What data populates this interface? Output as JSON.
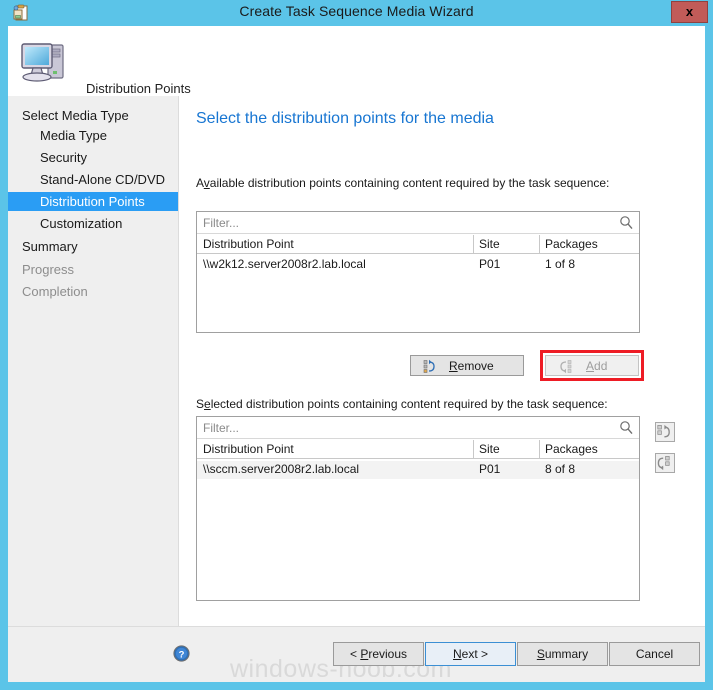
{
  "window": {
    "title": "Create Task Sequence Media Wizard",
    "title_icon": "task-sequence-clipboard-icon",
    "close_label": "x",
    "border_color": "#5bc4e8"
  },
  "header": {
    "icon": "computer-monitor-icon",
    "title": "Distribution Points"
  },
  "sidebar": {
    "items": [
      {
        "label": "Select Media Type",
        "level": 0,
        "state": "normal"
      },
      {
        "label": "Media Type",
        "level": 1,
        "state": "normal"
      },
      {
        "label": "Security",
        "level": 1,
        "state": "normal"
      },
      {
        "label": "Stand-Alone CD/DVD",
        "level": 1,
        "state": "normal"
      },
      {
        "label": "Distribution Points",
        "level": 1,
        "state": "selected"
      },
      {
        "label": "Customization",
        "level": 1,
        "state": "normal"
      },
      {
        "label": "Summary",
        "level": 0,
        "state": "normal"
      },
      {
        "label": "Progress",
        "level": 0,
        "state": "disabled"
      },
      {
        "label": "Completion",
        "level": 0,
        "state": "disabled"
      }
    ],
    "selected_color": "#2a9df4"
  },
  "main": {
    "heading": "Select the distribution points for the media",
    "heading_color": "#1876d2",
    "available": {
      "label_prefix": "A",
      "label_accel": "v",
      "label_suffix": "ailable distribution points containing content required by the task sequence:",
      "filter_placeholder": "Filter...",
      "search_icon": "search-icon",
      "columns": [
        "Distribution Point",
        "Site",
        "Packages"
      ],
      "rows": [
        {
          "dp": "\\\\w2k12.server2008r2.lab.local",
          "site": "P01",
          "packages": "1 of 8",
          "selected": false
        }
      ]
    },
    "selected_list": {
      "label_prefix": "S",
      "label_accel": "e",
      "label_suffix": "lected distribution points containing content required by the task sequence:",
      "filter_placeholder": "Filter...",
      "search_icon": "search-icon",
      "columns": [
        "Distribution Point",
        "Site",
        "Packages"
      ],
      "rows": [
        {
          "dp": "\\\\sccm.server2008r2.lab.local",
          "site": "P01",
          "packages": "8 of 8",
          "selected": true
        }
      ]
    },
    "transfer_buttons": {
      "remove": {
        "prefix": "",
        "accel": "R",
        "suffix": "emove",
        "icon": "remove-list-icon",
        "enabled": true
      },
      "add": {
        "prefix": "",
        "accel": "A",
        "suffix": "dd",
        "icon": "add-list-icon",
        "enabled": false,
        "highlight_color": "#ee1c25"
      }
    },
    "side_icon_buttons": [
      {
        "icon": "move-out-icon"
      },
      {
        "icon": "move-in-icon"
      }
    ]
  },
  "footer": {
    "help_icon": "help-question-icon",
    "watermark": "windows-noob.com",
    "buttons": [
      {
        "prefix": "< ",
        "accel": "P",
        "suffix": "revious",
        "focused": false
      },
      {
        "prefix": "",
        "accel": "N",
        "suffix": "ext >",
        "focused": true
      },
      {
        "prefix": "",
        "accel": "S",
        "suffix": "ummary",
        "focused": false
      },
      {
        "prefix": "",
        "accel": "C",
        "suffix": "ancel",
        "focused": false
      }
    ]
  }
}
